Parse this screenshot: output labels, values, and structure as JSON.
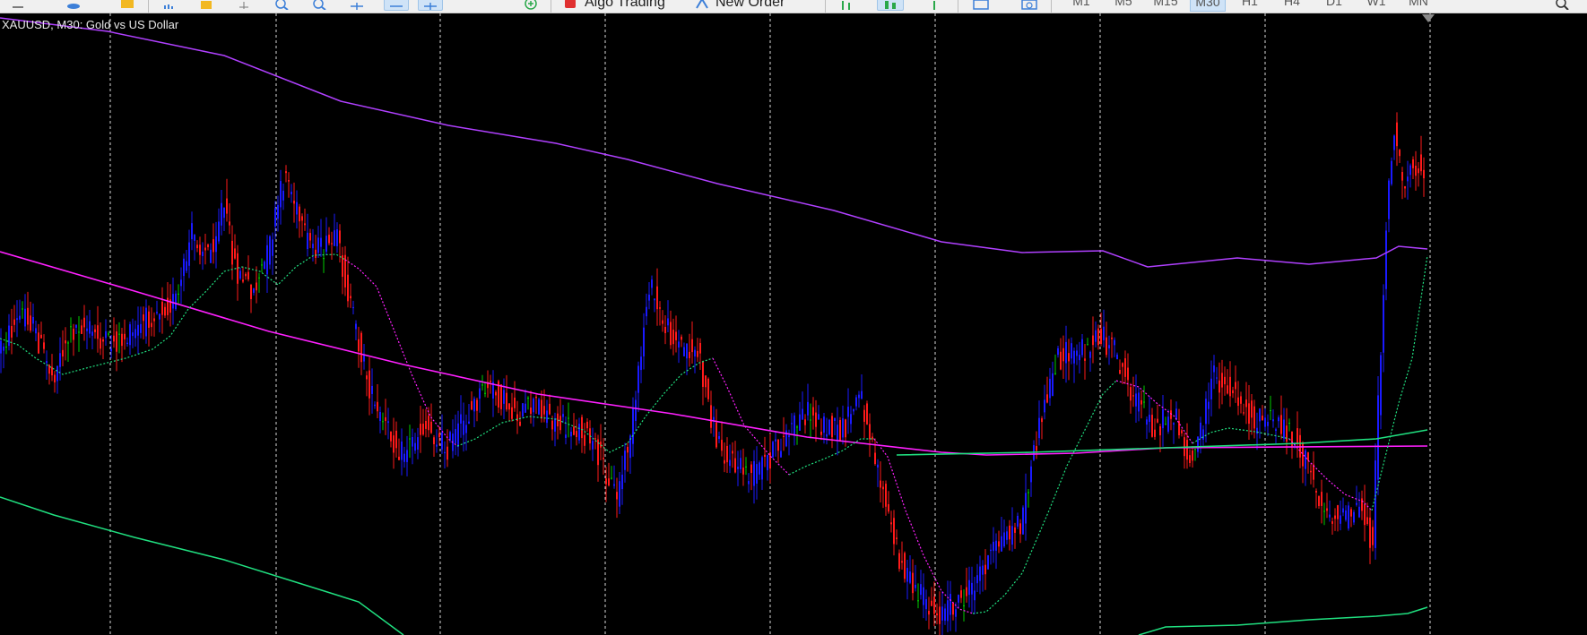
{
  "toolbar": {
    "algo_trading_label": "Algo Trading",
    "new_order_label": "New Order",
    "timeframes": [
      {
        "label": "M1",
        "active": false
      },
      {
        "label": "M5",
        "active": false
      },
      {
        "label": "M15",
        "active": false
      },
      {
        "label": "M30",
        "active": true
      },
      {
        "label": "H1",
        "active": false
      },
      {
        "label": "H4",
        "active": false
      },
      {
        "label": "D1",
        "active": false
      },
      {
        "label": "W1",
        "active": false
      },
      {
        "label": "MN",
        "active": false
      }
    ]
  },
  "chart_header": {
    "title": "XAUUSD, M30:  Gold vs US Dollar"
  },
  "colors": {
    "background": "#000000",
    "bull_candle": "#1a1aff",
    "bear_candle": "#ff1a1a",
    "doji_candle": "#00cc00",
    "grid": "#ffffff",
    "upper_band": "#b040ff",
    "middle_ma": "#ff20ff",
    "lower_band": "#20e080",
    "fast_ma_dotted_green": "#20e080",
    "fast_ma_dotted_magenta": "#ff20ff"
  },
  "icons": [
    "chart-icon",
    "database-icon",
    "folder-icon",
    "zoom-in-icon",
    "zoom-out-icon",
    "grid-icon",
    "period-separator-icon",
    "add-indicator-icon",
    "algo-trading-icon",
    "new-order-icon",
    "tile-windows-icon",
    "screenshot-icon",
    "search-icon"
  ]
}
